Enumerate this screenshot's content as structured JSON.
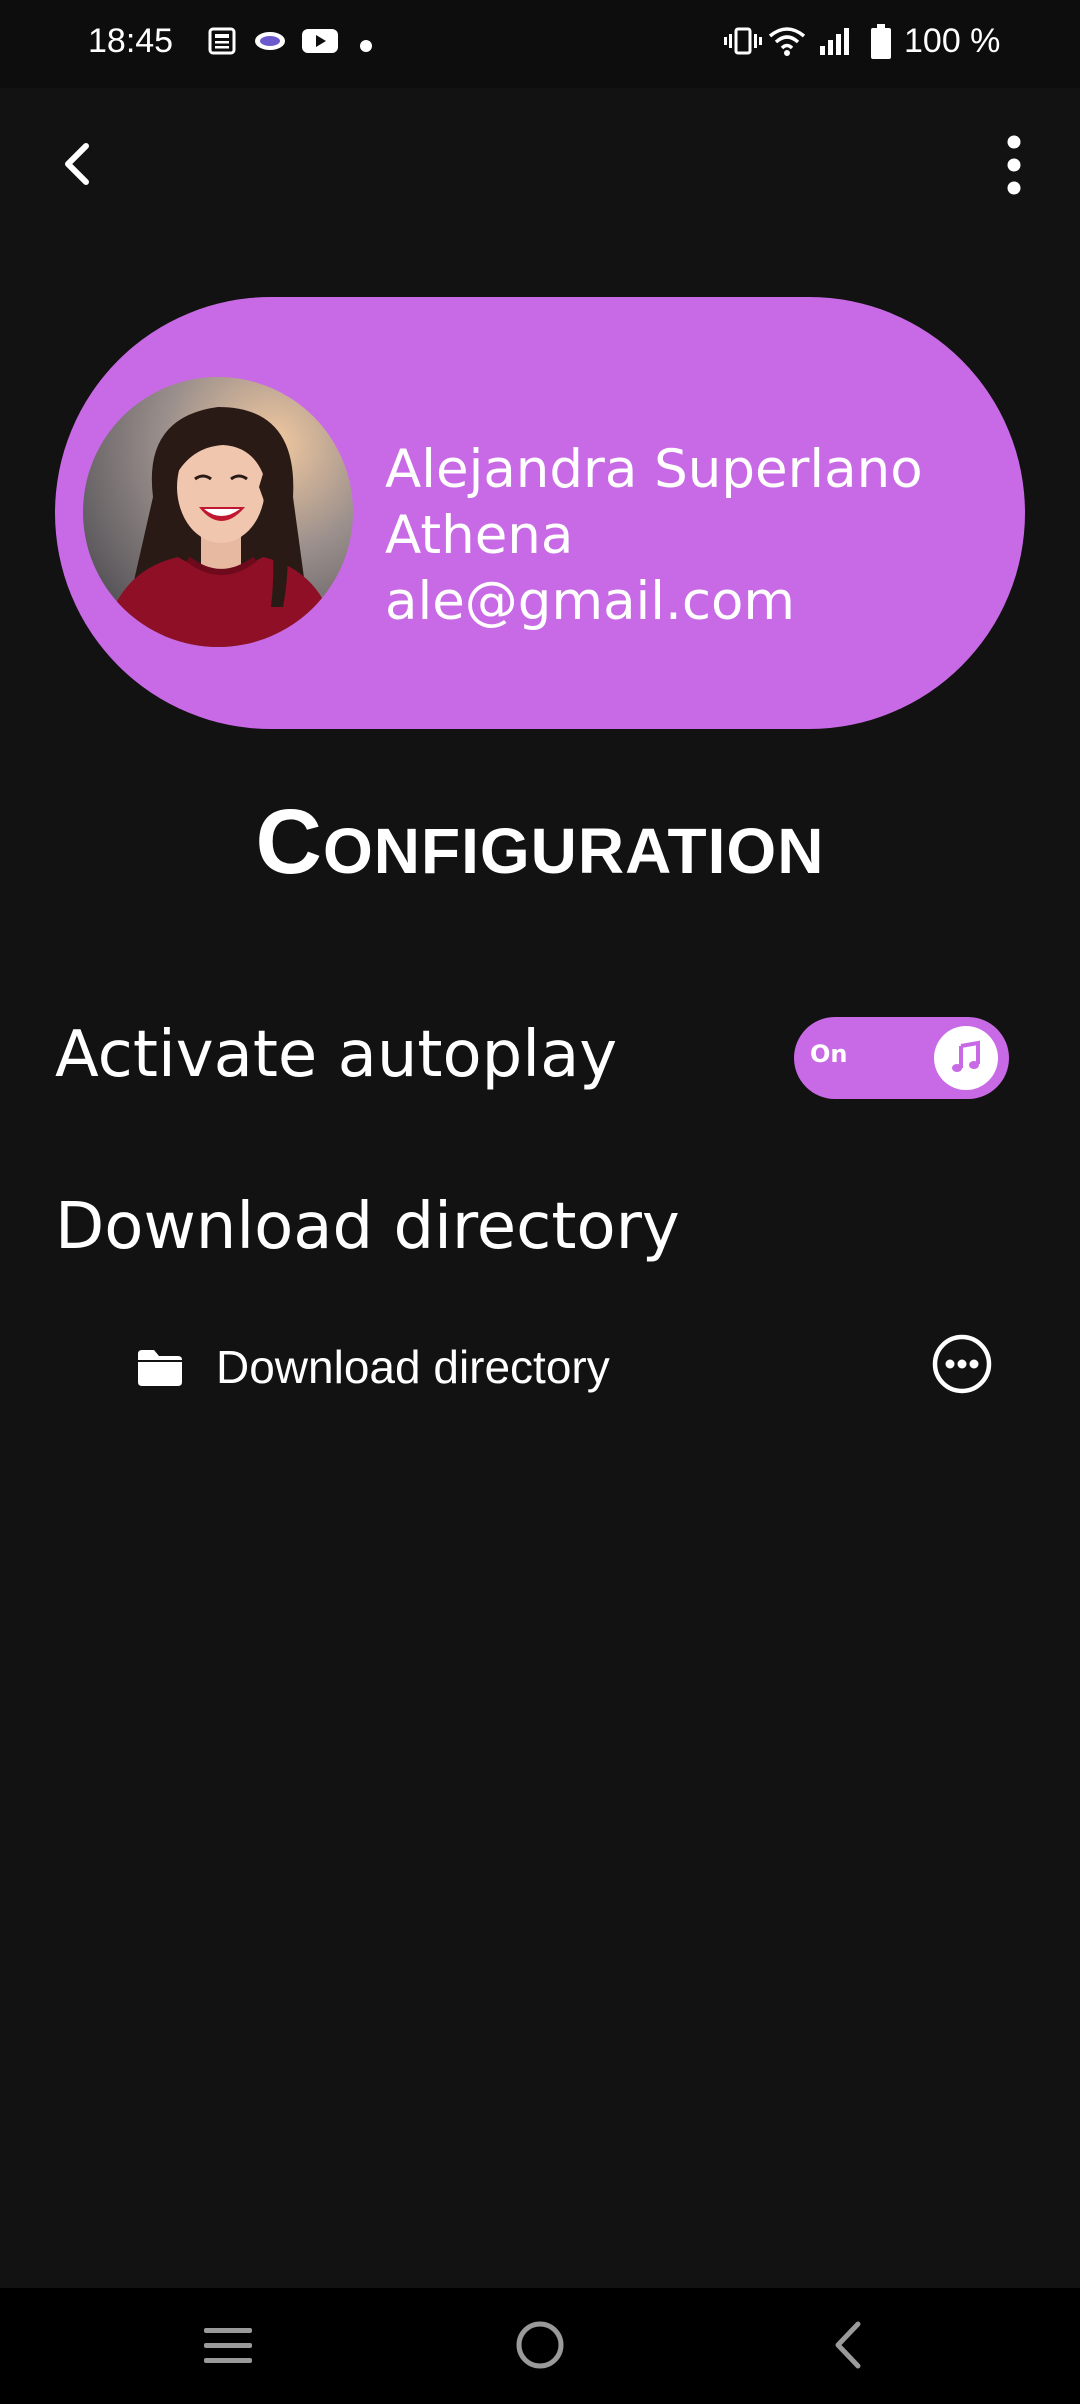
{
  "status_bar": {
    "time": "18:45",
    "battery_text": "100 %",
    "left_icons": [
      "news-icon",
      "chat-icon",
      "youtube-icon",
      "dot-icon"
    ],
    "right_icons": [
      "vibrate-icon",
      "wifi-icon",
      "signal-icon",
      "battery-icon"
    ]
  },
  "app_bar": {
    "back_icon": "back-arrow-icon",
    "menu_icon": "more-vertical-icon"
  },
  "profile": {
    "first_name": "Alejandra Superlano",
    "last_name": "Athena",
    "email": "ale@gmail.com",
    "card_color": "#c86ae5"
  },
  "page": {
    "title": "Configuration"
  },
  "settings": {
    "autoplay_label": "Activate autoplay",
    "autoplay_toggle_text": "On",
    "autoplay_toggle_state": true,
    "autoplay_knob_icon": "music-note-icon",
    "download_heading": "Download directory",
    "download_item_label": "Download directory",
    "download_item_icon": "folder-icon",
    "download_more_icon": "more-horizontal-circle-icon"
  },
  "nav_bar": {
    "icons": [
      "recents-icon",
      "home-icon",
      "back-icon"
    ]
  },
  "colors": {
    "background": "#121212",
    "accent": "#c86ae5"
  }
}
